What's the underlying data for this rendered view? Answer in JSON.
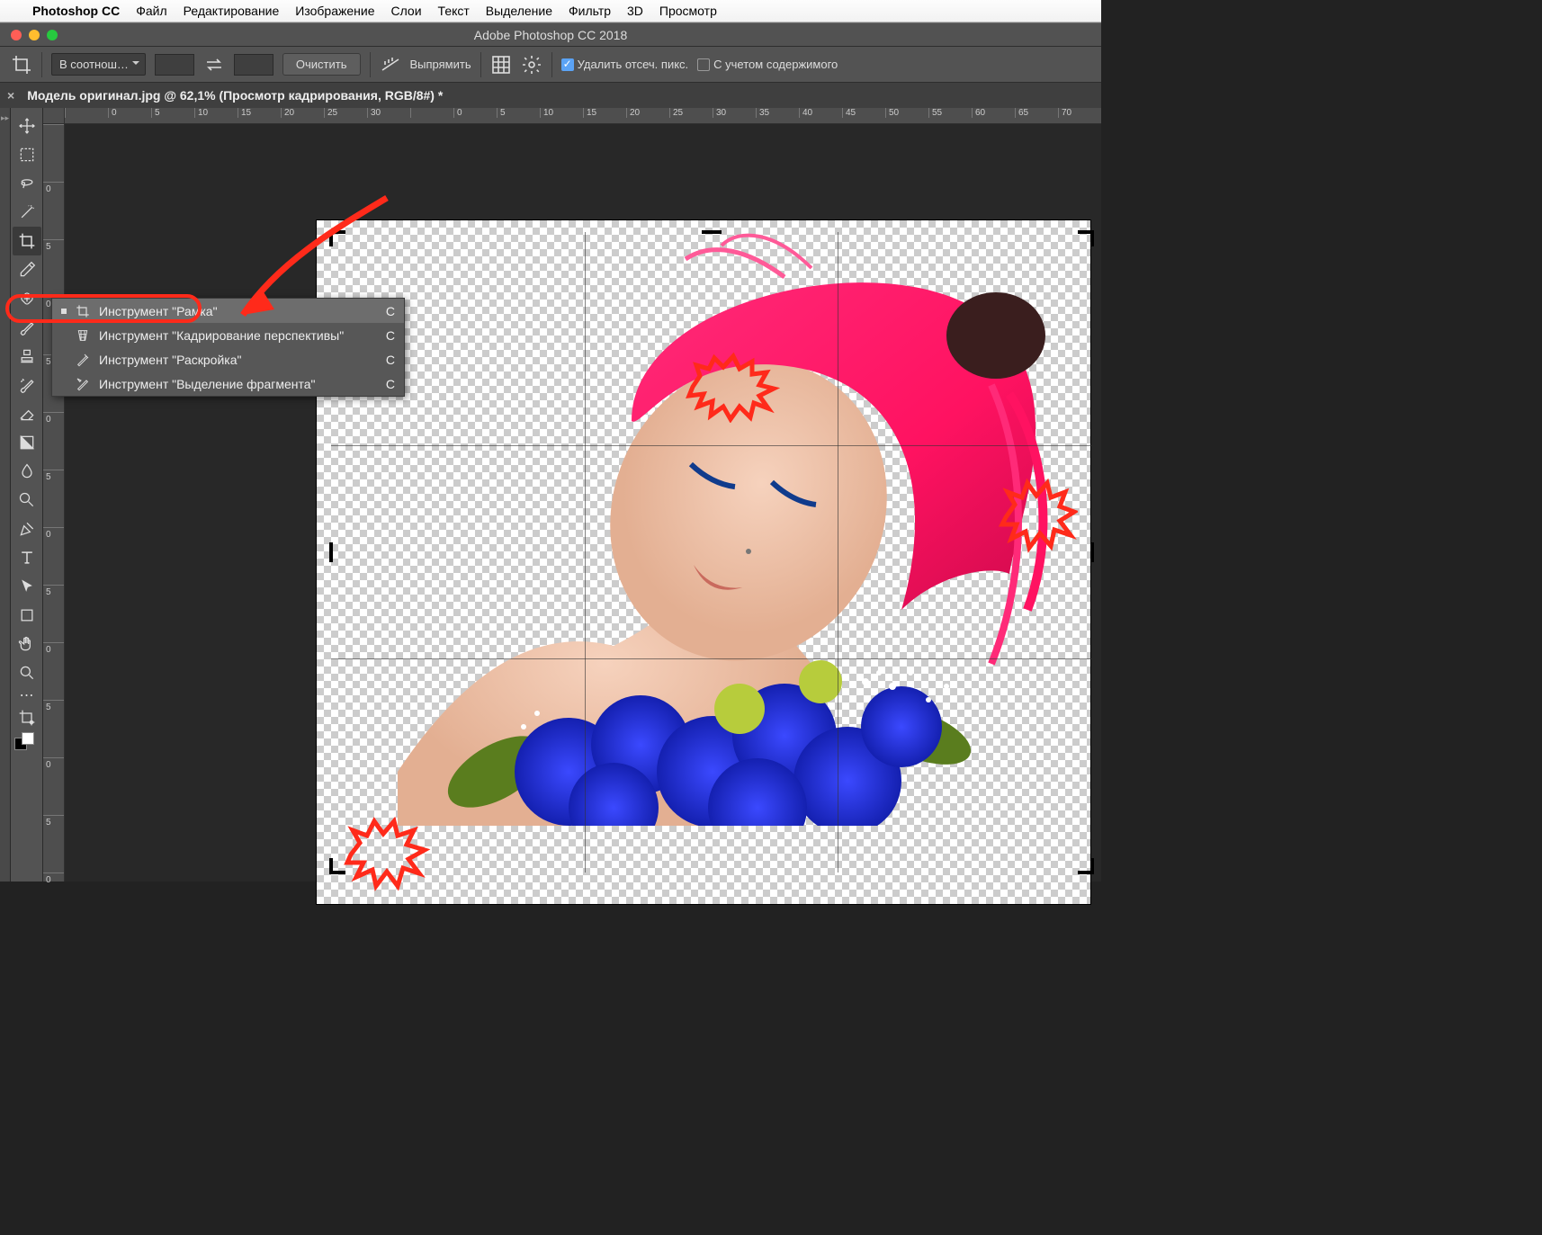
{
  "mac_menu": {
    "app": "Photoshop CC",
    "items": [
      "Файл",
      "Редактирование",
      "Изображение",
      "Слои",
      "Текст",
      "Выделение",
      "Фильтр",
      "3D",
      "Просмотр"
    ]
  },
  "title_bar": {
    "title": "Adobe Photoshop CC 2018"
  },
  "options_bar": {
    "ratio_preset": "В соотнош…",
    "clear_btn": "Очистить",
    "straighten": "Выпрямить",
    "delete_cropped": "Удалить отсеч. пикс.",
    "content_aware": "С учетом содержимого"
  },
  "doc_tab": {
    "title": "Модель оригинал.jpg @ 62,1% (Просмотр кадрирования, RGB/8#) *"
  },
  "ruler_h": [
    "",
    "0",
    "5",
    "10",
    "15",
    "20",
    "25",
    "30",
    "",
    "0",
    "5",
    "10",
    "15",
    "20",
    "25",
    "30",
    "35",
    "40",
    "45",
    "50",
    "55",
    "60",
    "65",
    "70"
  ],
  "ruler_v": [
    "",
    "0",
    "5",
    "0",
    "5",
    "0",
    "5",
    "0",
    "5",
    "0",
    "5",
    "0",
    "5",
    "0"
  ],
  "flyout": {
    "current_indicator": "▪",
    "items": [
      {
        "label": "Инструмент \"Рамка\"",
        "shortcut": "C",
        "selected": true,
        "icon": "crop"
      },
      {
        "label": "Инструмент \"Кадрирование перспективы\"",
        "shortcut": "C",
        "selected": false,
        "icon": "persp"
      },
      {
        "label": "Инструмент \"Раскройка\"",
        "shortcut": "C",
        "selected": false,
        "icon": "slice"
      },
      {
        "label": "Инструмент \"Выделение фрагмента\"",
        "shortcut": "C",
        "selected": false,
        "icon": "slicesel"
      }
    ]
  }
}
